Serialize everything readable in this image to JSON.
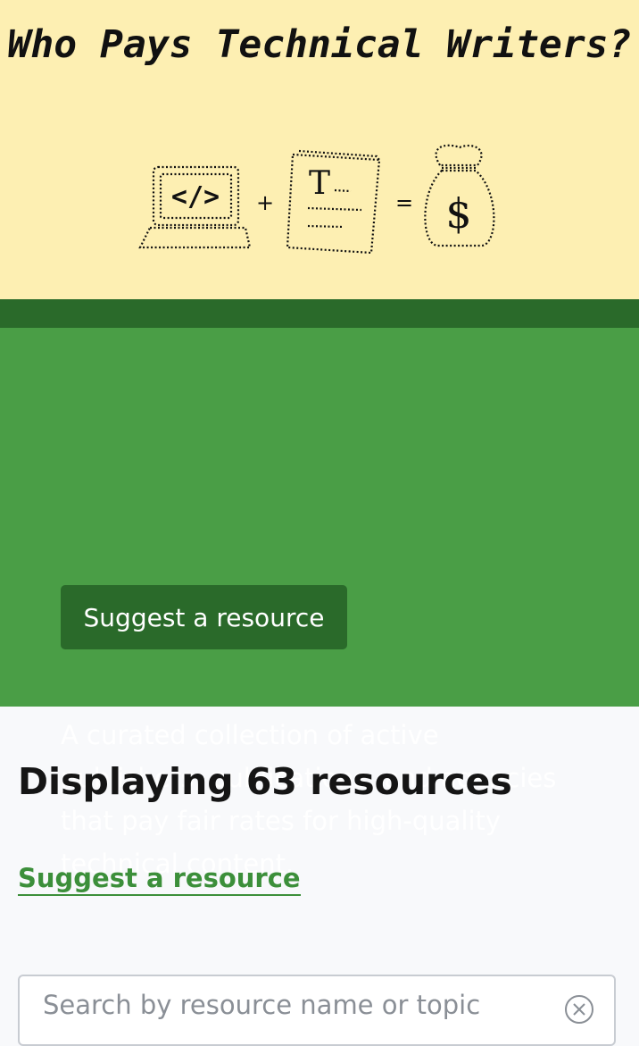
{
  "header": {
    "title": "Who Pays Technical Writers?",
    "illustration": {
      "code_symbol": "</>",
      "plus": "+",
      "doc_letter": "T",
      "equals": "=",
      "money": "$"
    }
  },
  "intro": {
    "text": "A curated collection of active publishers, publications, and agencies that pay fair rates for high-quality technical content.",
    "button_label": "Suggest a resource"
  },
  "results": {
    "count_text": "Displaying 63 resources",
    "suggest_link": "Suggest a resource"
  },
  "search": {
    "placeholder": "Search by resource name or topic",
    "value": ""
  },
  "colors": {
    "hero_bg": "#fdefb2",
    "band": "#2a6a2a",
    "green": "#4a9e46",
    "link": "#3c8f3a"
  },
  "icons": {
    "laptop": "laptop-icon",
    "document": "document-icon",
    "money_bag": "money-bag-icon",
    "clear": "clear-icon"
  }
}
